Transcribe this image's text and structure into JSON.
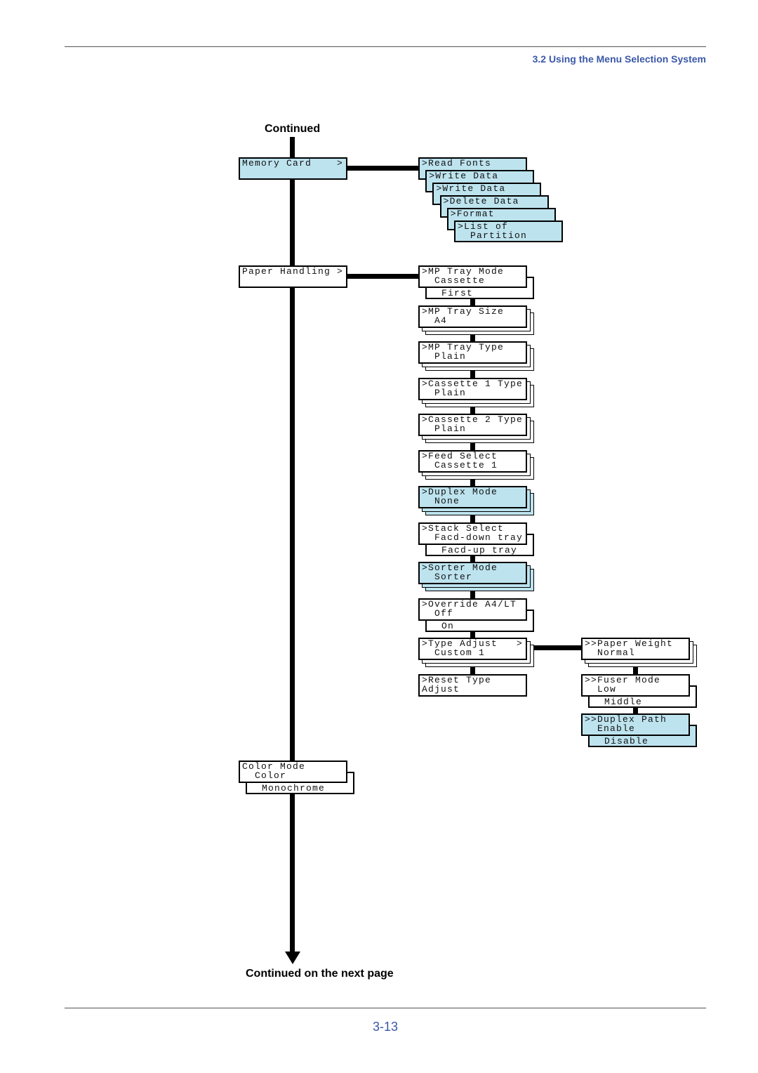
{
  "header": {
    "section": "3.2 Using the Menu Selection System"
  },
  "captions": {
    "top": "Continued",
    "bottom": "Continued on the next page"
  },
  "footer": {
    "page_number": "3-13"
  },
  "colors": {
    "highlight": "#bde3ee",
    "accent": "#3a58a8"
  },
  "menu": {
    "main": [
      {
        "lines": [
          "Memory Card    >"
        ],
        "highlight": true,
        "kind": "single"
      },
      {
        "lines": [
          "Paper Handling >"
        ],
        "highlight": false,
        "kind": "single"
      },
      {
        "lines": [
          "Color Mode",
          "  Color"
        ],
        "option": "  Monochrome",
        "highlight": false,
        "kind": "option"
      }
    ],
    "memory_card": [
      {
        "lines": [
          ">Read Fonts"
        ]
      },
      {
        "lines": [
          ">Write Data"
        ]
      },
      {
        "lines": [
          ">Write Data"
        ]
      },
      {
        "lines": [
          ">Delete Data"
        ]
      },
      {
        "lines": [
          ">Format"
        ]
      },
      {
        "lines": [
          ">List of",
          "  Partition"
        ]
      }
    ],
    "paper_handling": [
      {
        "lines": [
          ">MP Tray Mode",
          "  Cassette"
        ],
        "option": "  First",
        "kind": "option",
        "highlight": false
      },
      {
        "lines": [
          ">MP Tray Size",
          "  A4"
        ],
        "kind": "stack",
        "highlight": false
      },
      {
        "lines": [
          ">MP Tray Type",
          "  Plain"
        ],
        "kind": "stack",
        "highlight": false
      },
      {
        "lines": [
          ">Cassette 1 Type",
          "  Plain"
        ],
        "kind": "stack",
        "highlight": false
      },
      {
        "lines": [
          ">Cassette 2 Type",
          "  Plain"
        ],
        "kind": "stack",
        "highlight": false
      },
      {
        "lines": [
          ">Feed Select",
          "  Cassette 1"
        ],
        "kind": "stack",
        "highlight": false
      },
      {
        "lines": [
          ">Duplex Mode",
          "  None"
        ],
        "kind": "stack",
        "highlight": true
      },
      {
        "lines": [
          ">Stack Select",
          "  Facd-down tray"
        ],
        "option": "  Facd-up tray",
        "kind": "option",
        "highlight": false
      },
      {
        "lines": [
          ">Sorter Mode",
          "  Sorter"
        ],
        "kind": "stack",
        "highlight": true
      },
      {
        "lines": [
          ">Override A4/LT",
          "  Off"
        ],
        "option": "  On",
        "kind": "option",
        "highlight": false
      },
      {
        "lines": [
          ">Type Adjust   >",
          "  Custom 1"
        ],
        "kind": "stack",
        "highlight": false
      },
      {
        "lines": [
          ">Reset Type",
          "Adjust"
        ],
        "kind": "single",
        "highlight": false
      }
    ],
    "type_adjust": [
      {
        "lines": [
          ">>Paper Weight",
          "  Normal"
        ],
        "kind": "stack",
        "highlight": false
      },
      {
        "lines": [
          ">>Fuser Mode",
          "  Low"
        ],
        "option": "  Middle",
        "kind": "option",
        "highlight": false
      },
      {
        "lines": [
          ">>Duplex Path",
          "  Enable"
        ],
        "option": "  Disable",
        "kind": "option",
        "highlight": true
      }
    ]
  }
}
